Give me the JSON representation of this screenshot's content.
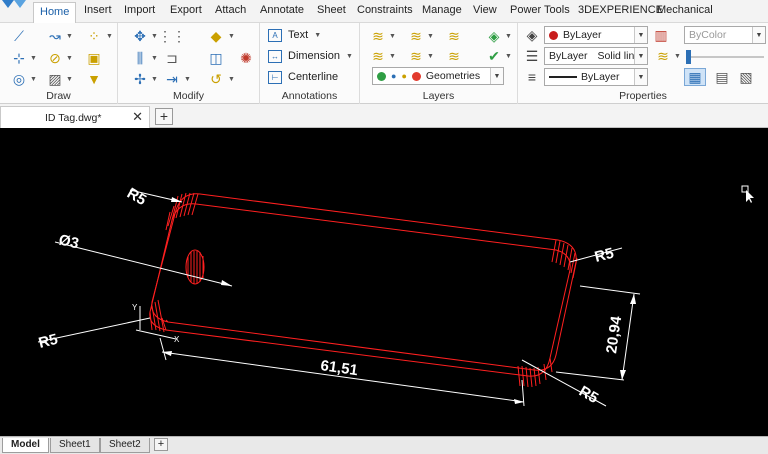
{
  "ribbon_tabs": [
    "Home",
    "Insert",
    "Import",
    "Export",
    "Attach",
    "Annotate",
    "Sheet",
    "Constraints",
    "Manage",
    "View",
    "Power Tools",
    "3DEXPERIENCE",
    "Mechanical"
  ],
  "groups": {
    "draw": "Draw",
    "modify": "Modify",
    "annotations": "Annotations",
    "layers": "Layers",
    "properties": "Properties"
  },
  "annotations": {
    "text": "Text",
    "dimension": "Dimension",
    "centerline": "Centerline"
  },
  "layers": {
    "current_layer": "Geometries",
    "layer_color": "#e23b2e"
  },
  "properties": {
    "color": "ByLayer",
    "linetype_layer": "ByLayer",
    "linetype": "Solid line",
    "lineweight": "ByLayer",
    "plot_style": "ByColor",
    "color_swatch": "#c81e1e"
  },
  "document": {
    "tab_title": "ID Tag.dwg*"
  },
  "drawing": {
    "dimensions": {
      "radius_top_left": "R5",
      "hole": "Ø3",
      "radius_bottom_left": "R5",
      "radius_top_right": "R5",
      "radius_bottom_right": "R5",
      "length": "61,51",
      "width": "20,94"
    },
    "ucs": {
      "y": "Y",
      "x": "X"
    },
    "geometry_color": "#ff2020",
    "dimension_color": "#ffffff"
  },
  "sheets": [
    "Model",
    "Sheet1",
    "Sheet2"
  ]
}
